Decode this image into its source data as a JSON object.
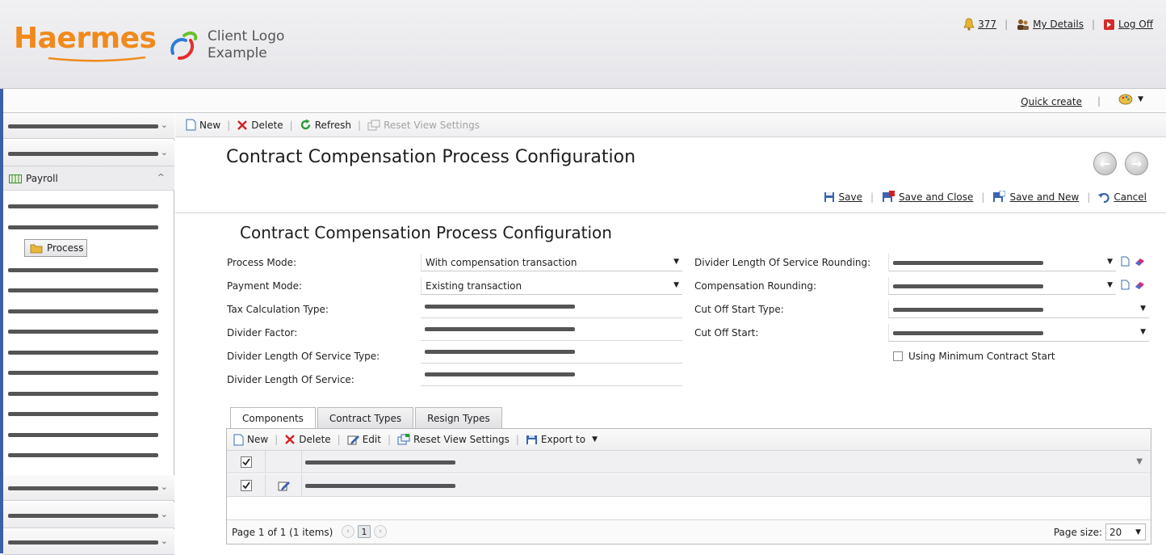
{
  "header": {
    "brand": "Haermes",
    "client_logo_line1": "Client Logo",
    "client_logo_line2": "Example",
    "notifications_count": "377",
    "my_details": "My Details",
    "log_off": "Log Off",
    "quick_create": "Quick create"
  },
  "sidebar": {
    "payroll_label": "Payroll",
    "process_label": "Process"
  },
  "toolbar": {
    "new": "New",
    "delete": "Delete",
    "refresh": "Refresh",
    "reset_view_settings": "Reset View Settings"
  },
  "page": {
    "title": "Contract Compensation Process Configuration",
    "form_title": "Contract Compensation Process Configuration"
  },
  "actions": {
    "save": "Save",
    "save_and_close": "Save and Close",
    "save_and_new": "Save and New",
    "cancel": "Cancel"
  },
  "form": {
    "process_mode_label": "Process Mode:",
    "process_mode_value": "With compensation transaction",
    "payment_mode_label": "Payment Mode:",
    "payment_mode_value": "Existing transaction",
    "tax_calc_label": "Tax Calculation Type:",
    "divider_factor_label": "Divider Factor:",
    "divider_los_type_label": "Divider Length Of Service Type:",
    "divider_los_label": "Divider Length Of Service:",
    "divider_los_rounding_label": "Divider Length Of Service Rounding:",
    "compensation_rounding_label": "Compensation Rounding:",
    "cutoff_start_type_label": "Cut Off Start Type:",
    "cutoff_start_label": "Cut Off Start:",
    "using_min_contract_start_label": "Using Minimum Contract Start"
  },
  "tabs": [
    "Components",
    "Contract Types",
    "Resign Types"
  ],
  "grid": {
    "toolbar": {
      "new": "New",
      "delete": "Delete",
      "edit": "Edit",
      "reset_view_settings": "Reset View Settings",
      "export_to": "Export to"
    },
    "pager_text": "Page 1 of 1 (1 items)",
    "current_page": "1",
    "page_size_label": "Page size:",
    "page_size_value": "20"
  },
  "colors": {
    "brand_orange": "#f08a1c",
    "header_bg": "#ececef",
    "left_edge_blue": "#3c5fa8"
  }
}
